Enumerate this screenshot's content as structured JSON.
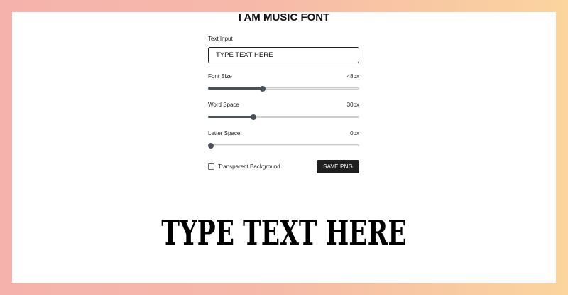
{
  "title": "I AM MUSIC FONT",
  "text_input": {
    "label": "Text Input",
    "value": "TYPE TEXT HERE"
  },
  "font_size": {
    "label": "Font Size",
    "value_text": "48px",
    "fraction": 0.36
  },
  "word_space": {
    "label": "Word Space",
    "value_text": "30px",
    "fraction": 0.3
  },
  "letter_space": {
    "label": "Letter Space",
    "value_text": "0px",
    "fraction": 0.0
  },
  "transparent_background": {
    "label": "Transparent Background",
    "checked": false
  },
  "save_button": {
    "label": "SAVE PNG"
  },
  "preview": {
    "text": "TYPE TEXT HERE"
  },
  "colors": {
    "slider_fill": "#4a505a",
    "button_bg": "#1f1f1f"
  }
}
